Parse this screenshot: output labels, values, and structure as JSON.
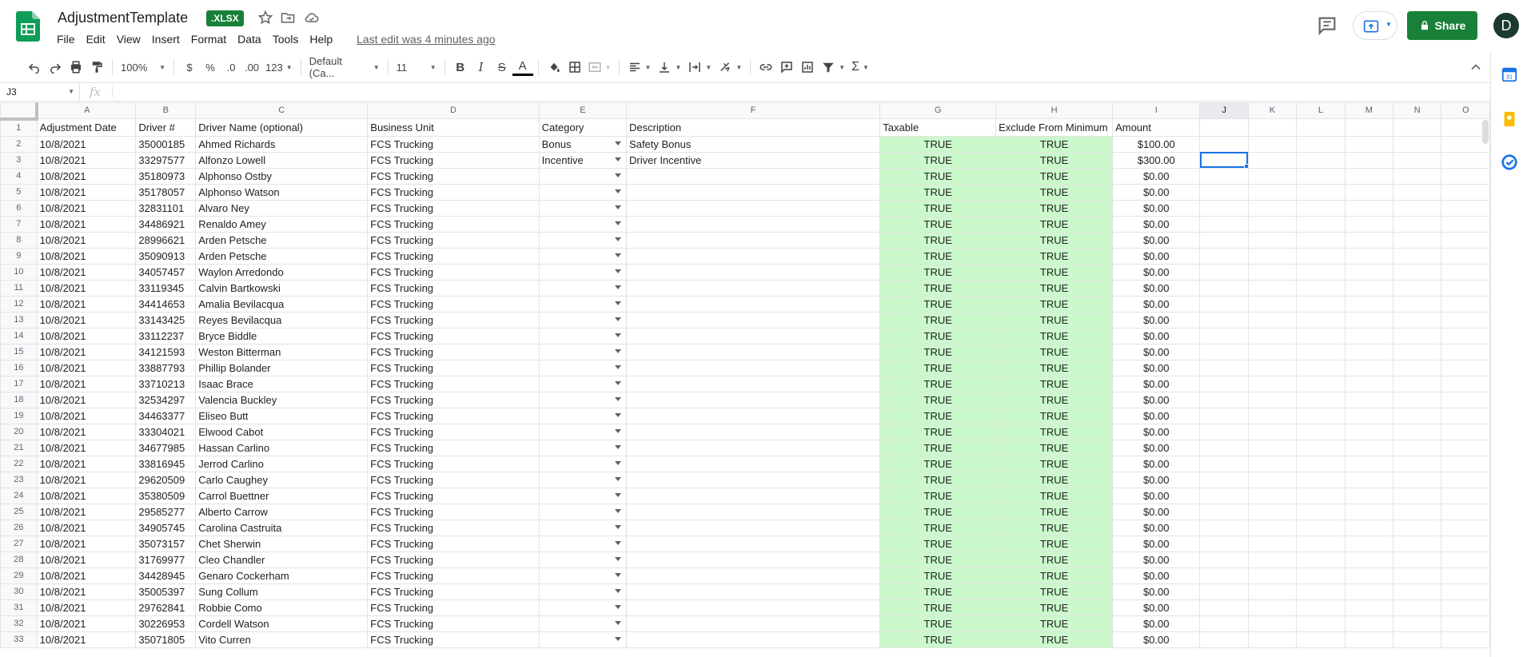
{
  "doc": {
    "title": "AdjustmentTemplate",
    "badge": ".XLSX",
    "last_edit": "Last edit was 4 minutes ago"
  },
  "menu": [
    "File",
    "Edit",
    "View",
    "Insert",
    "Format",
    "Data",
    "Tools",
    "Help"
  ],
  "header": {
    "share_label": "Share",
    "avatar_initial": "D"
  },
  "toolbar": {
    "zoom": "100%",
    "currency": "$",
    "percent": "%",
    "dec_decrease": ".0",
    "dec_increase": ".00",
    "more_formats": "123",
    "font": "Default (Ca...",
    "font_size": "11",
    "bold": "B",
    "italic": "I",
    "strike": "S",
    "text_color": "A"
  },
  "formula_bar": {
    "cell_ref": "J3",
    "fx": "fx",
    "value": ""
  },
  "columns": [
    "A",
    "B",
    "C",
    "D",
    "E",
    "F",
    "G",
    "H",
    "I",
    "J",
    "K",
    "L",
    "M",
    "N",
    "O"
  ],
  "selected_column": "J",
  "headers": [
    "Adjustment Date",
    "Driver #",
    "Driver Name (optional)",
    "Business Unit",
    "Category",
    "Description",
    "Taxable",
    "Exclude From Minimum",
    "Amount"
  ],
  "rows": [
    {
      "date": "10/8/2021",
      "driver": "35000185",
      "name": " Ahmed Richards",
      "unit": "FCS Trucking",
      "category": "Bonus",
      "description": "Safety Bonus",
      "taxable": "TRUE",
      "exclude": "TRUE",
      "amount": "$100.00"
    },
    {
      "date": "10/8/2021",
      "driver": "33297577",
      "name": " Alfonzo Lowell",
      "unit": "FCS Trucking",
      "category": "Incentive",
      "description": "Driver Incentive",
      "taxable": "TRUE",
      "exclude": "TRUE",
      "amount": "$300.00"
    },
    {
      "date": "10/8/2021",
      "driver": "35180973",
      "name": " Alphonso Ostby",
      "unit": "FCS Trucking",
      "category": "",
      "description": "",
      "taxable": "TRUE",
      "exclude": "TRUE",
      "amount": "$0.00"
    },
    {
      "date": "10/8/2021",
      "driver": "35178057",
      "name": " Alphonso Watson",
      "unit": "FCS Trucking",
      "category": "",
      "description": "",
      "taxable": "TRUE",
      "exclude": "TRUE",
      "amount": "$0.00"
    },
    {
      "date": "10/8/2021",
      "driver": "32831101",
      "name": " Alvaro Ney",
      "unit": "FCS Trucking",
      "category": "",
      "description": "",
      "taxable": "TRUE",
      "exclude": "TRUE",
      "amount": "$0.00"
    },
    {
      "date": "10/8/2021",
      "driver": "34486921",
      "name": "Renaldo Amey",
      "unit": "FCS Trucking",
      "category": "",
      "description": "",
      "taxable": "TRUE",
      "exclude": "TRUE",
      "amount": "$0.00"
    },
    {
      "date": "10/8/2021",
      "driver": "28996621",
      "name": " Arden Petsche",
      "unit": "FCS Trucking",
      "category": "",
      "description": "",
      "taxable": "TRUE",
      "exclude": "TRUE",
      "amount": "$0.00"
    },
    {
      "date": "10/8/2021",
      "driver": "35090913",
      "name": " Arden Petsche",
      "unit": "FCS Trucking",
      "category": "",
      "description": "",
      "taxable": "TRUE",
      "exclude": "TRUE",
      "amount": "$0.00"
    },
    {
      "date": "10/8/2021",
      "driver": "34057457",
      "name": "Waylon Arredondo",
      "unit": "FCS Trucking",
      "category": "",
      "description": "",
      "taxable": "TRUE",
      "exclude": "TRUE",
      "amount": "$0.00"
    },
    {
      "date": "10/8/2021",
      "driver": "33119345",
      "name": "Calvin Bartkowski",
      "unit": "FCS Trucking",
      "category": "",
      "description": "",
      "taxable": "TRUE",
      "exclude": "TRUE",
      "amount": "$0.00"
    },
    {
      "date": "10/8/2021",
      "driver": "34414653",
      "name": "Amalia Bevilacqua",
      "unit": "FCS Trucking",
      "category": "",
      "description": "",
      "taxable": "TRUE",
      "exclude": "TRUE",
      "amount": "$0.00"
    },
    {
      "date": "10/8/2021",
      "driver": "33143425",
      "name": "Reyes Bevilacqua",
      "unit": "FCS Trucking",
      "category": "",
      "description": "",
      "taxable": "TRUE",
      "exclude": "TRUE",
      "amount": "$0.00"
    },
    {
      "date": "10/8/2021",
      "driver": "33112237",
      "name": "Bryce Biddle",
      "unit": "FCS Trucking",
      "category": "",
      "description": "",
      "taxable": "TRUE",
      "exclude": "TRUE",
      "amount": "$0.00"
    },
    {
      "date": "10/8/2021",
      "driver": "34121593",
      "name": "Weston Bitterman",
      "unit": "FCS Trucking",
      "category": "",
      "description": "",
      "taxable": "TRUE",
      "exclude": "TRUE",
      "amount": "$0.00"
    },
    {
      "date": "10/8/2021",
      "driver": "33887793",
      "name": "Phillip Bolander",
      "unit": "FCS Trucking",
      "category": "",
      "description": "",
      "taxable": "TRUE",
      "exclude": "TRUE",
      "amount": "$0.00"
    },
    {
      "date": "10/8/2021",
      "driver": "33710213",
      "name": "Isaac Brace",
      "unit": "FCS Trucking",
      "category": "",
      "description": "",
      "taxable": "TRUE",
      "exclude": "TRUE",
      "amount": "$0.00"
    },
    {
      "date": "10/8/2021",
      "driver": "32534297",
      "name": "Valencia Buckley",
      "unit": "FCS Trucking",
      "category": "",
      "description": "",
      "taxable": "TRUE",
      "exclude": "TRUE",
      "amount": "$0.00"
    },
    {
      "date": "10/8/2021",
      "driver": "34463377",
      "name": "Eliseo Butt",
      "unit": "FCS Trucking",
      "category": "",
      "description": "",
      "taxable": "TRUE",
      "exclude": "TRUE",
      "amount": "$0.00"
    },
    {
      "date": "10/8/2021",
      "driver": "33304021",
      "name": "Elwood Cabot",
      "unit": "FCS Trucking",
      "category": "",
      "description": "",
      "taxable": "TRUE",
      "exclude": "TRUE",
      "amount": "$0.00"
    },
    {
      "date": "10/8/2021",
      "driver": "34677985",
      "name": "Hassan Carlino",
      "unit": "FCS Trucking",
      "category": "",
      "description": "",
      "taxable": "TRUE",
      "exclude": "TRUE",
      "amount": "$0.00"
    },
    {
      "date": "10/8/2021",
      "driver": "33816945",
      "name": "Jerrod Carlino",
      "unit": "FCS Trucking",
      "category": "",
      "description": "",
      "taxable": "TRUE",
      "exclude": "TRUE",
      "amount": "$0.00"
    },
    {
      "date": "10/8/2021",
      "driver": "29620509",
      "name": " Carlo Caughey",
      "unit": "FCS Trucking",
      "category": "",
      "description": "",
      "taxable": "TRUE",
      "exclude": "TRUE",
      "amount": "$0.00"
    },
    {
      "date": "10/8/2021",
      "driver": "35380509",
      "name": " Carrol Buettner",
      "unit": "FCS Trucking",
      "category": "",
      "description": "",
      "taxable": "TRUE",
      "exclude": "TRUE",
      "amount": "$0.00"
    },
    {
      "date": "10/8/2021",
      "driver": "29585277",
      "name": " Alberto Carrow",
      "unit": "FCS Trucking",
      "category": "",
      "description": "",
      "taxable": "TRUE",
      "exclude": "TRUE",
      "amount": "$0.00"
    },
    {
      "date": "10/8/2021",
      "driver": "34905745",
      "name": "Carolina Castruita",
      "unit": "FCS Trucking",
      "category": "",
      "description": "",
      "taxable": "TRUE",
      "exclude": "TRUE",
      "amount": "$0.00"
    },
    {
      "date": "10/8/2021",
      "driver": "35073157",
      "name": " Chet Sherwin",
      "unit": "FCS Trucking",
      "category": "",
      "description": "",
      "taxable": "TRUE",
      "exclude": "TRUE",
      "amount": "$0.00"
    },
    {
      "date": "10/8/2021",
      "driver": "31769977",
      "name": " Cleo Chandler",
      "unit": "FCS Trucking",
      "category": "",
      "description": "",
      "taxable": "TRUE",
      "exclude": "TRUE",
      "amount": "$0.00"
    },
    {
      "date": "10/8/2021",
      "driver": "34428945",
      "name": "Genaro Cockerham",
      "unit": "FCS Trucking",
      "category": "",
      "description": "",
      "taxable": "TRUE",
      "exclude": "TRUE",
      "amount": "$0.00"
    },
    {
      "date": "10/8/2021",
      "driver": "35005397",
      "name": "Sung Collum",
      "unit": "FCS Trucking",
      "category": "",
      "description": "",
      "taxable": "TRUE",
      "exclude": "TRUE",
      "amount": "$0.00"
    },
    {
      "date": "10/8/2021",
      "driver": "29762841",
      "name": "Robbie Como",
      "unit": "FCS Trucking",
      "category": "",
      "description": "",
      "taxable": "TRUE",
      "exclude": "TRUE",
      "amount": "$0.00"
    },
    {
      "date": "10/8/2021",
      "driver": "30226953",
      "name": " Cordell Watson",
      "unit": "FCS Trucking",
      "category": "",
      "description": "",
      "taxable": "TRUE",
      "exclude": "TRUE",
      "amount": "$0.00"
    },
    {
      "date": "10/8/2021",
      "driver": "35071805",
      "name": "Vito Curren",
      "unit": "FCS Trucking",
      "category": "",
      "description": "",
      "taxable": "TRUE",
      "exclude": "TRUE",
      "amount": "$0.00"
    }
  ],
  "colors": {
    "brand_green": "#188038",
    "true_fill": "#ccf9cb",
    "selection": "#1a73e8"
  }
}
